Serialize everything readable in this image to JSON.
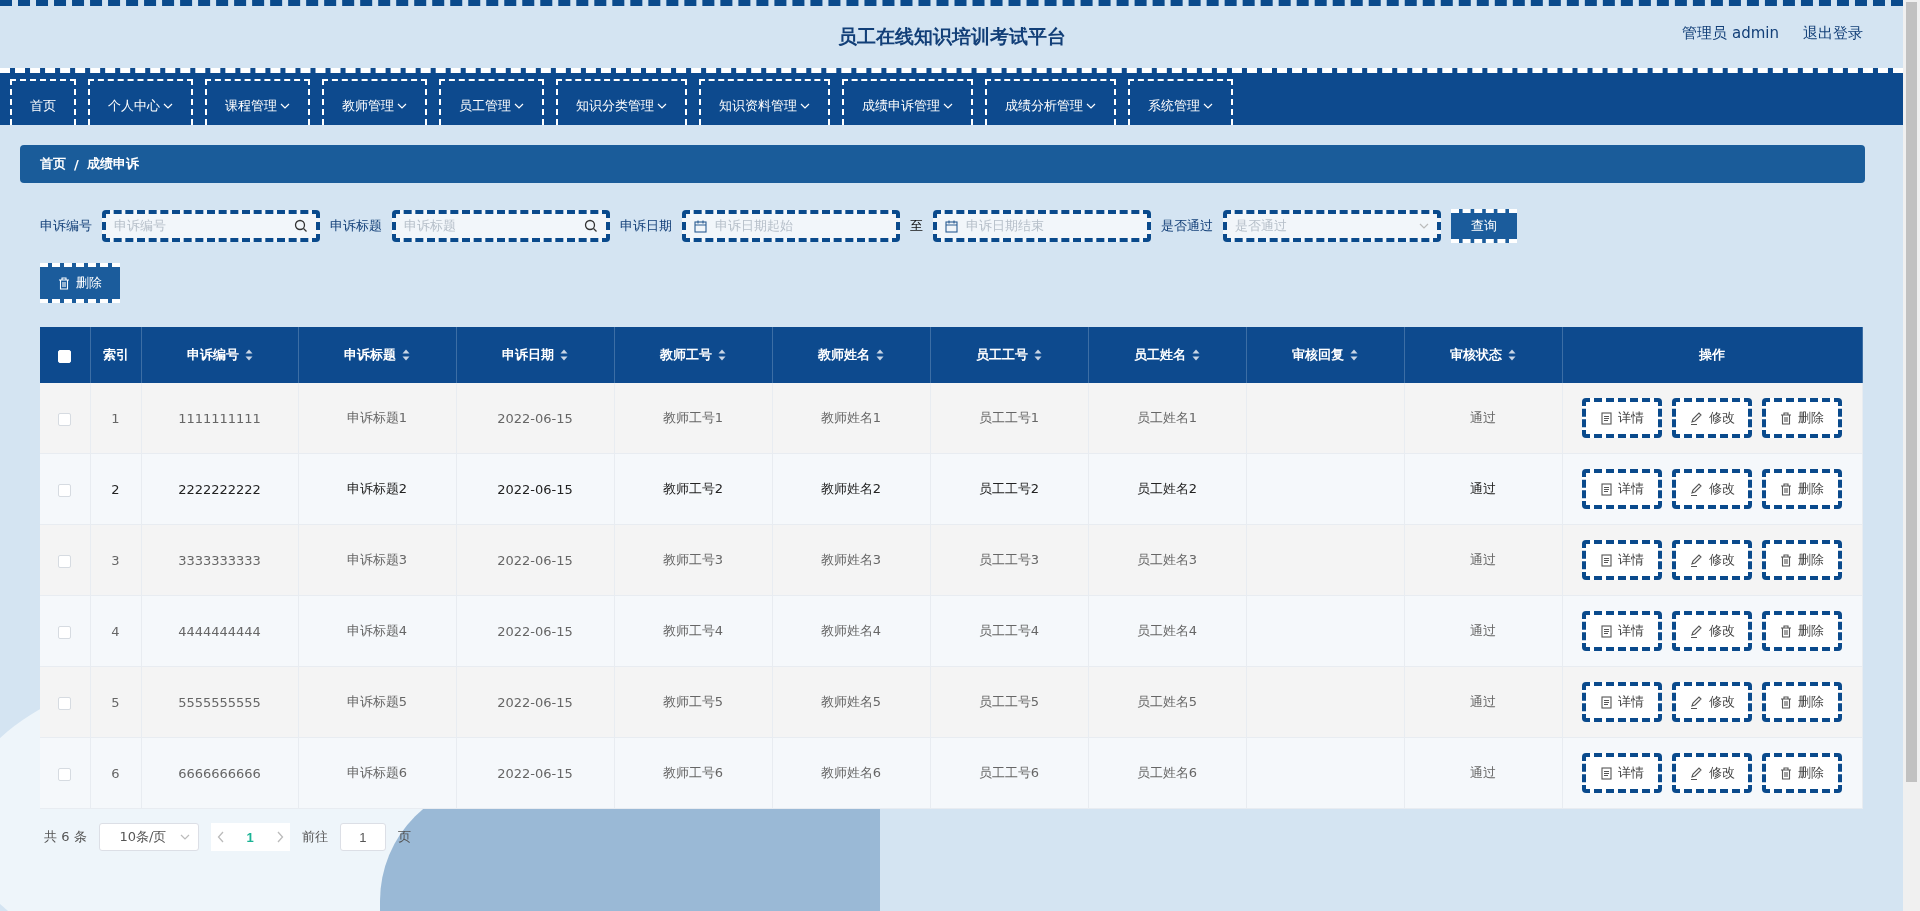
{
  "header": {
    "title": "员工在线知识培训考试平台",
    "user": "管理员 admin",
    "logout": "退出登录"
  },
  "nav": [
    {
      "label": "首页",
      "dropdown": false,
      "selected": false
    },
    {
      "label": "个人中心",
      "dropdown": true,
      "selected": false
    },
    {
      "label": "课程管理",
      "dropdown": true,
      "selected": false
    },
    {
      "label": "教师管理",
      "dropdown": true,
      "selected": false
    },
    {
      "label": "员工管理",
      "dropdown": true,
      "selected": false
    },
    {
      "label": "知识分类管理",
      "dropdown": true,
      "selected": false
    },
    {
      "label": "知识资料管理",
      "dropdown": true,
      "selected": false
    },
    {
      "label": "成绩申诉管理",
      "dropdown": true,
      "selected": false
    },
    {
      "label": "成绩分析管理",
      "dropdown": true,
      "selected": false
    },
    {
      "label": "系统管理",
      "dropdown": true,
      "selected": false
    }
  ],
  "breadcrumb": {
    "items": [
      "首页",
      "成绩申诉"
    ],
    "separator": "/"
  },
  "filters": [
    {
      "label": "申诉编号",
      "kind": "search",
      "placeholder": "申诉编号"
    },
    {
      "label": "申诉标题",
      "kind": "search",
      "placeholder": "申诉标题"
    },
    {
      "label": "申诉日期",
      "kind": "daterange",
      "placeholder": "申诉日期起始",
      "separator": "至",
      "placeholder_end": "申诉日期结束"
    },
    {
      "label": "是否通过",
      "kind": "select",
      "placeholder": "是否通过"
    }
  ],
  "query_button": "查询",
  "delete_button": "删除",
  "table": {
    "header_checked": false,
    "columns": [
      {
        "label": "索引",
        "sortable": false
      },
      {
        "label": "申诉编号",
        "sortable": true
      },
      {
        "label": "申诉标题",
        "sortable": true
      },
      {
        "label": "申诉日期",
        "sortable": true
      },
      {
        "label": "教师工号",
        "sortable": true
      },
      {
        "label": "教师姓名",
        "sortable": true
      },
      {
        "label": "员工工号",
        "sortable": true
      },
      {
        "label": "员工姓名",
        "sortable": true
      },
      {
        "label": "审核回复",
        "sortable": true
      },
      {
        "label": "审核状态",
        "sortable": true
      },
      {
        "label": "操作",
        "sortable": false
      }
    ],
    "rows": [
      {
        "checked": false,
        "hovered": false,
        "cells": [
          "1",
          "1111111111",
          "申诉标题1",
          "2022-06-15",
          "教师工号1",
          "教师姓名1",
          "员工工号1",
          "员工姓名1",
          "",
          "通过"
        ],
        "actions": [
          "详情",
          "修改",
          "删除"
        ]
      },
      {
        "checked": false,
        "hovered": true,
        "cells": [
          "2",
          "2222222222",
          "申诉标题2",
          "2022-06-15",
          "教师工号2",
          "教师姓名2",
          "员工工号2",
          "员工姓名2",
          "",
          "通过"
        ],
        "actions": [
          "详情",
          "修改",
          "删除"
        ]
      },
      {
        "checked": false,
        "hovered": false,
        "cells": [
          "3",
          "3333333333",
          "申诉标题3",
          "2022-06-15",
          "教师工号3",
          "教师姓名3",
          "员工工号3",
          "员工姓名3",
          "",
          "通过"
        ],
        "actions": [
          "详情",
          "修改",
          "删除"
        ]
      },
      {
        "checked": false,
        "hovered": false,
        "cells": [
          "4",
          "4444444444",
          "申诉标题4",
          "2022-06-15",
          "教师工号4",
          "教师姓名4",
          "员工工号4",
          "员工姓名4",
          "",
          "通过"
        ],
        "actions": [
          "详情",
          "修改",
          "删除"
        ]
      },
      {
        "checked": false,
        "hovered": false,
        "cells": [
          "5",
          "5555555555",
          "申诉标题5",
          "2022-06-15",
          "教师工号5",
          "教师姓名5",
          "员工工号5",
          "员工姓名5",
          "",
          "通过"
        ],
        "actions": [
          "详情",
          "修改",
          "删除"
        ]
      },
      {
        "checked": false,
        "hovered": false,
        "cells": [
          "6",
          "6666666666",
          "申诉标题6",
          "2022-06-15",
          "教师工号6",
          "教师姓名6",
          "员工工号6",
          "员工姓名6",
          "",
          "通过"
        ],
        "actions": [
          "详情",
          "修改",
          "删除"
        ]
      }
    ]
  },
  "pagination": {
    "total": "共 6 条",
    "page_size": "10条/页",
    "pages": [
      {
        "label": "1",
        "selected": true
      }
    ],
    "goto_label": "前往",
    "goto_value": "1",
    "goto_suffix": "页"
  }
}
